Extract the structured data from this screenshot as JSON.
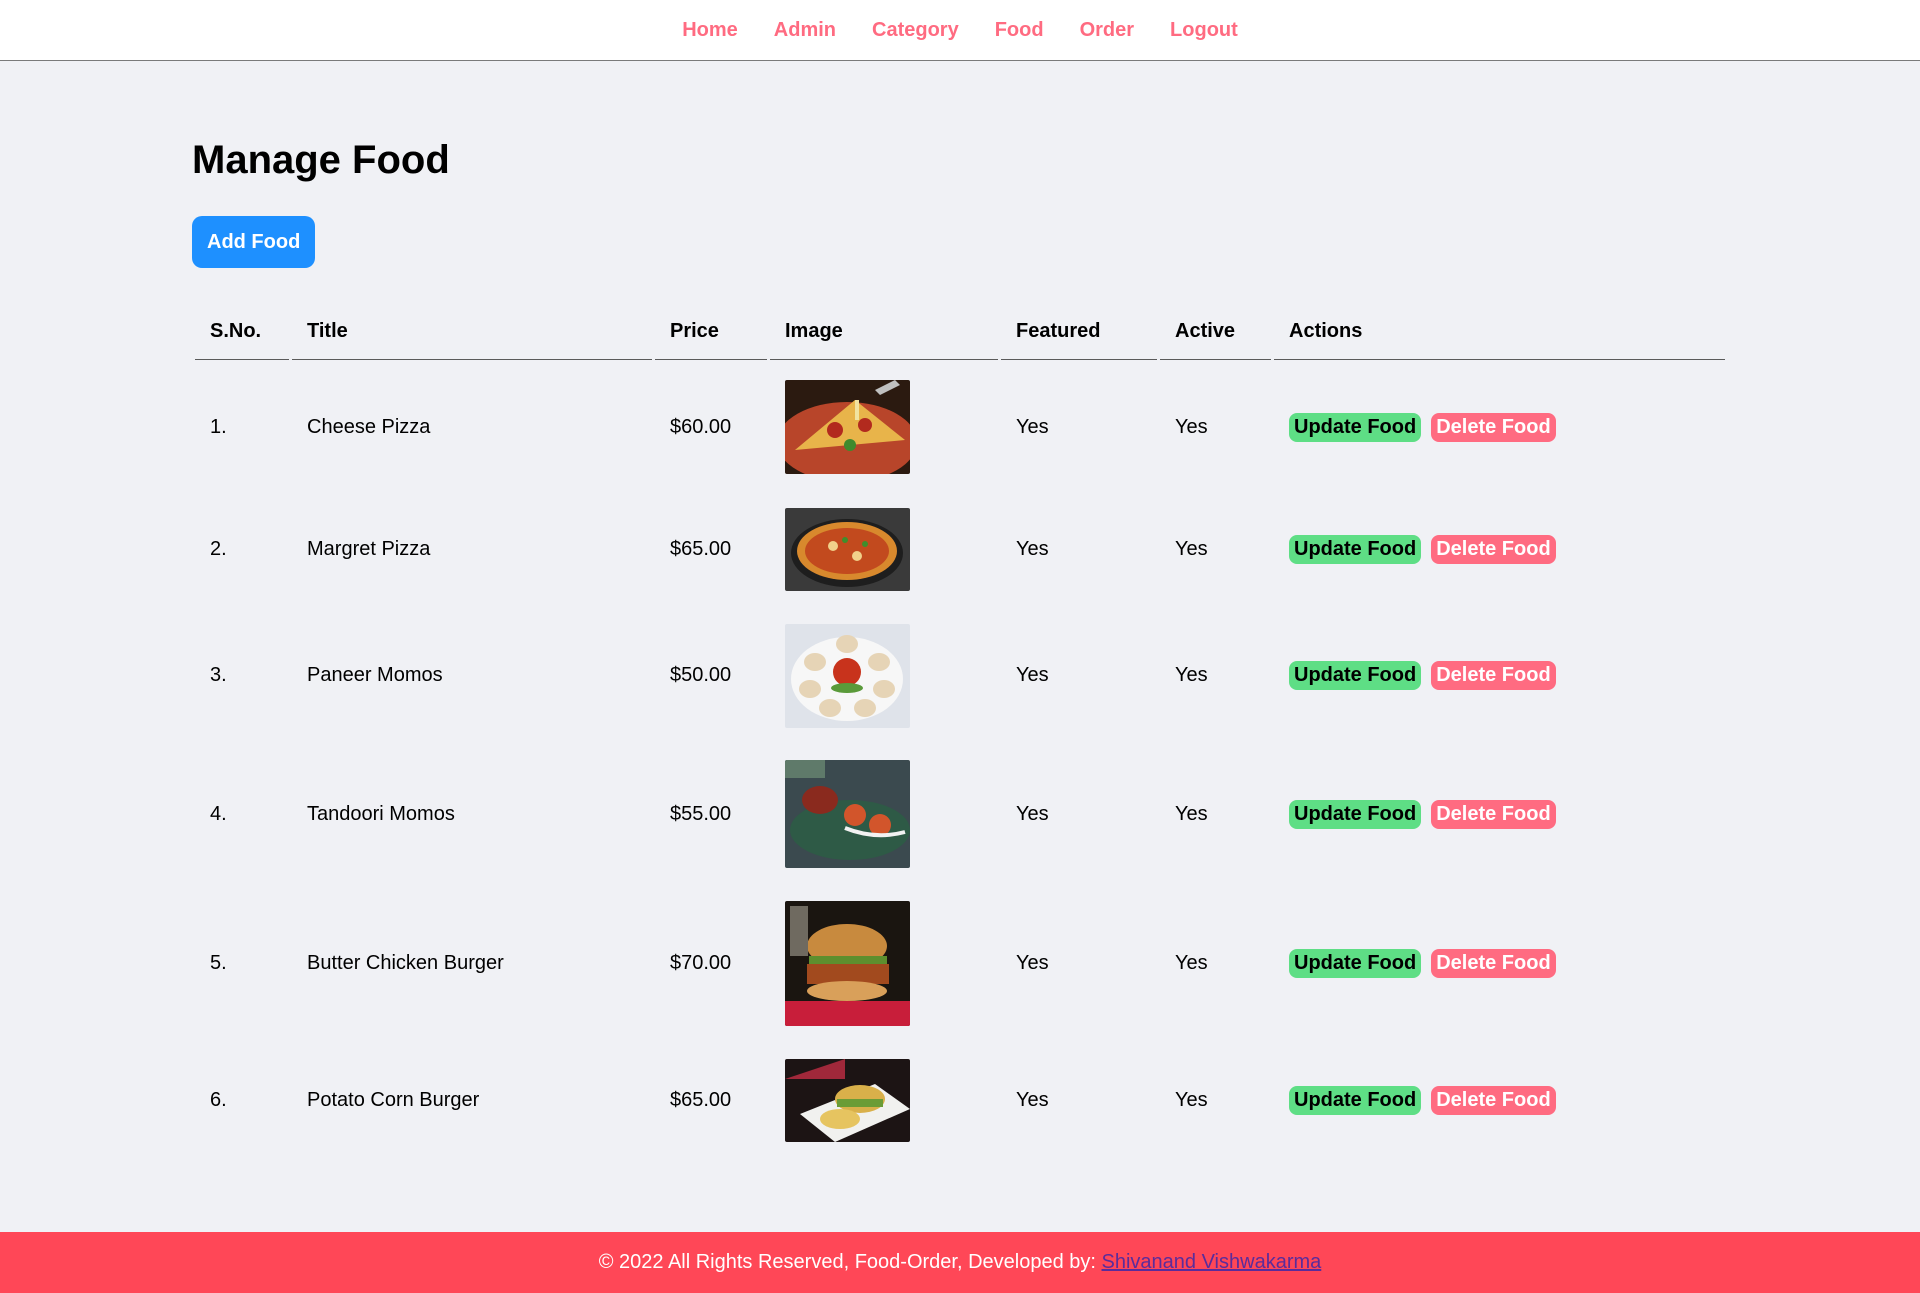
{
  "nav": {
    "items": [
      "Home",
      "Admin",
      "Category",
      "Food",
      "Order",
      "Logout"
    ]
  },
  "main": {
    "title": "Manage Food",
    "add_button": "Add Food",
    "table": {
      "headers": [
        "S.No.",
        "Title",
        "Price",
        "Image",
        "Featured",
        "Active",
        "Actions"
      ],
      "rows": [
        {
          "sno": "1.",
          "title": "Cheese Pizza",
          "price": "$60.00",
          "image": "cheese-pizza-image",
          "featured": "Yes",
          "active": "Yes"
        },
        {
          "sno": "2.",
          "title": "Margret Pizza",
          "price": "$65.00",
          "image": "margret-pizza-image",
          "featured": "Yes",
          "active": "Yes"
        },
        {
          "sno": "3.",
          "title": "Paneer Momos",
          "price": "$50.00",
          "image": "paneer-momos-image",
          "featured": "Yes",
          "active": "Yes"
        },
        {
          "sno": "4.",
          "title": "Tandoori Momos",
          "price": "$55.00",
          "image": "tandoori-momos-image",
          "featured": "Yes",
          "active": "Yes"
        },
        {
          "sno": "5.",
          "title": "Butter Chicken Burger",
          "price": "$70.00",
          "image": "butter-chicken-burger-image",
          "featured": "Yes",
          "active": "Yes"
        },
        {
          "sno": "6.",
          "title": "Potato Corn Burger",
          "price": "$65.00",
          "image": "potato-corn-burger-image",
          "featured": "Yes",
          "active": "Yes"
        }
      ],
      "update_label": "Update Food",
      "delete_label": "Delete Food"
    }
  },
  "footer": {
    "text": "© 2022 All Rights Reserved, Food-Order, Developed by: ",
    "link": "Shivanand Vishwakarma"
  },
  "colors": {
    "nav_link": "#ff6b81",
    "primary_button": "#1e90ff",
    "update_button": "#5ede85",
    "delete_button": "#ff6b81",
    "footer_bg": "#ff4757",
    "page_bg": "#f0f1f5"
  }
}
